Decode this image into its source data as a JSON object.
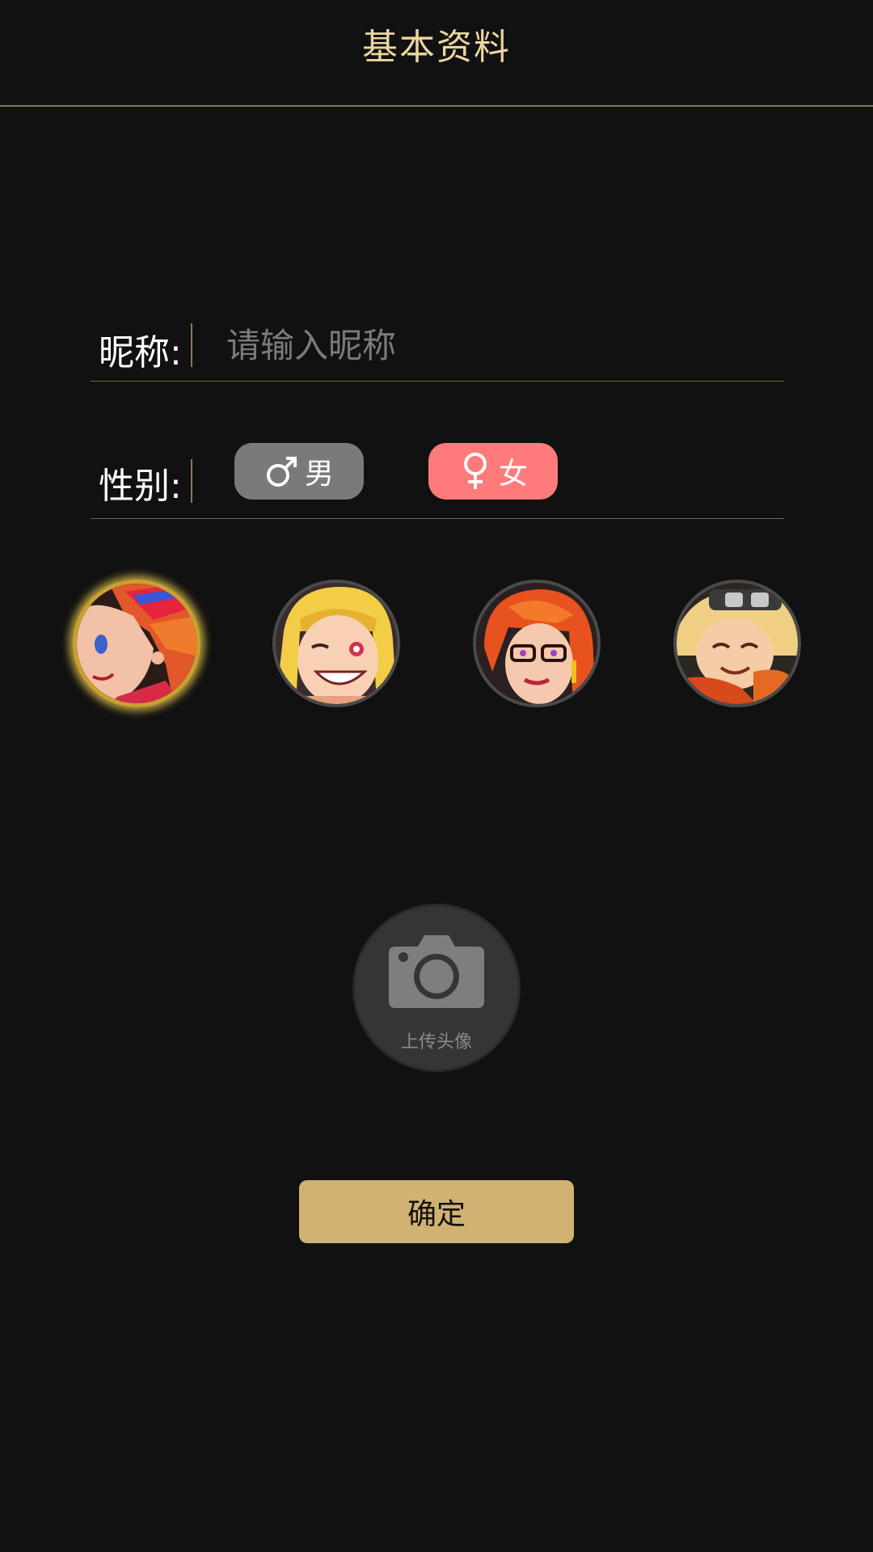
{
  "header": {
    "title": "基本资料"
  },
  "form": {
    "nickname": {
      "label": "昵称:",
      "value": "",
      "placeholder": "请输入昵称"
    },
    "gender": {
      "label": "性别:",
      "options": [
        {
          "label": "男",
          "icon": "male-symbol-icon",
          "color": "#7a7a7a",
          "selected": false
        },
        {
          "label": "女",
          "icon": "female-symbol-icon",
          "color": "#ff7b7b",
          "selected": true
        }
      ]
    }
  },
  "avatars": {
    "selected_index": 0,
    "items": [
      {
        "icon": "avatar-red-hair-girl-icon"
      },
      {
        "icon": "avatar-blonde-winking-girl-icon"
      },
      {
        "icon": "avatar-orange-hair-glasses-woman-icon"
      },
      {
        "icon": "avatar-blonde-goggles-boy-icon"
      }
    ]
  },
  "upload": {
    "label": "上传头像",
    "icon": "camera-icon"
  },
  "confirm_button": {
    "label": "确定"
  },
  "colors": {
    "background": "#111111",
    "accent_gold": "#d1b273",
    "title_gold": "#ecd6a0",
    "female_pink": "#ff7b7b",
    "male_gray": "#7a7a7a"
  }
}
